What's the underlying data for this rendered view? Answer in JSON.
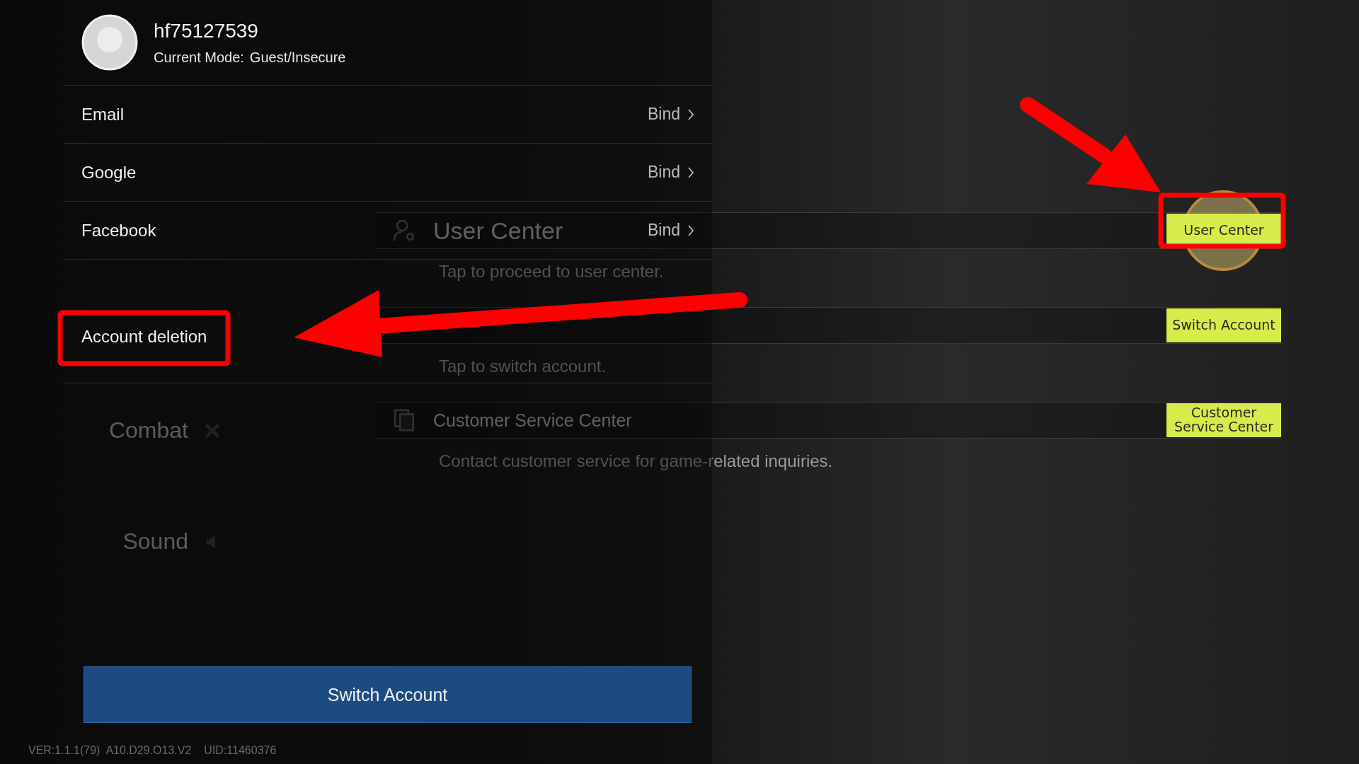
{
  "settings_nav": [
    {
      "kind": "combat",
      "label": "Combat"
    },
    {
      "kind": "sound",
      "label": "Sound"
    }
  ],
  "account_options": [
    {
      "kind": "user",
      "title": "User Center",
      "description": "Tap to proceed to user center.",
      "button": "User Center"
    },
    {
      "kind": "switch",
      "description": "Tap to switch account.",
      "button": "Switch Account"
    },
    {
      "kind": "service",
      "title": "Customer Service Center",
      "description": "Contact customer service for game-related inquiries.",
      "button": "Customer Service Center"
    }
  ],
  "account_panel": {
    "username": "hf75127539",
    "mode_label": "Current Mode:",
    "mode_value": "Guest/Insecure",
    "bindings": [
      {
        "label": "Email",
        "action": "Bind"
      },
      {
        "label": "Google",
        "action": "Bind"
      },
      {
        "label": "Facebook",
        "action": "Bind"
      }
    ],
    "account_deletion": "Account deletion",
    "switch_button": "Switch Account",
    "version": "VER:1.1.1(79)  A10.D29.O13.V2",
    "uid": "UID:11460376"
  }
}
